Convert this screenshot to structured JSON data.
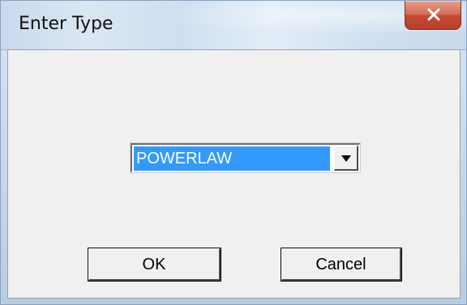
{
  "window": {
    "title": "Enter Type"
  },
  "icons": {
    "close": "close-icon",
    "dropdown": "chevron-down-icon"
  },
  "dialog": {
    "type_select": {
      "selected_value": "POWERLAW"
    },
    "buttons": {
      "ok_label": "OK",
      "cancel_label": "Cancel"
    }
  },
  "colors": {
    "selection_highlight": "#3399ff",
    "close_button": "#c44b33",
    "dialog_background": "#f0f0f0"
  }
}
